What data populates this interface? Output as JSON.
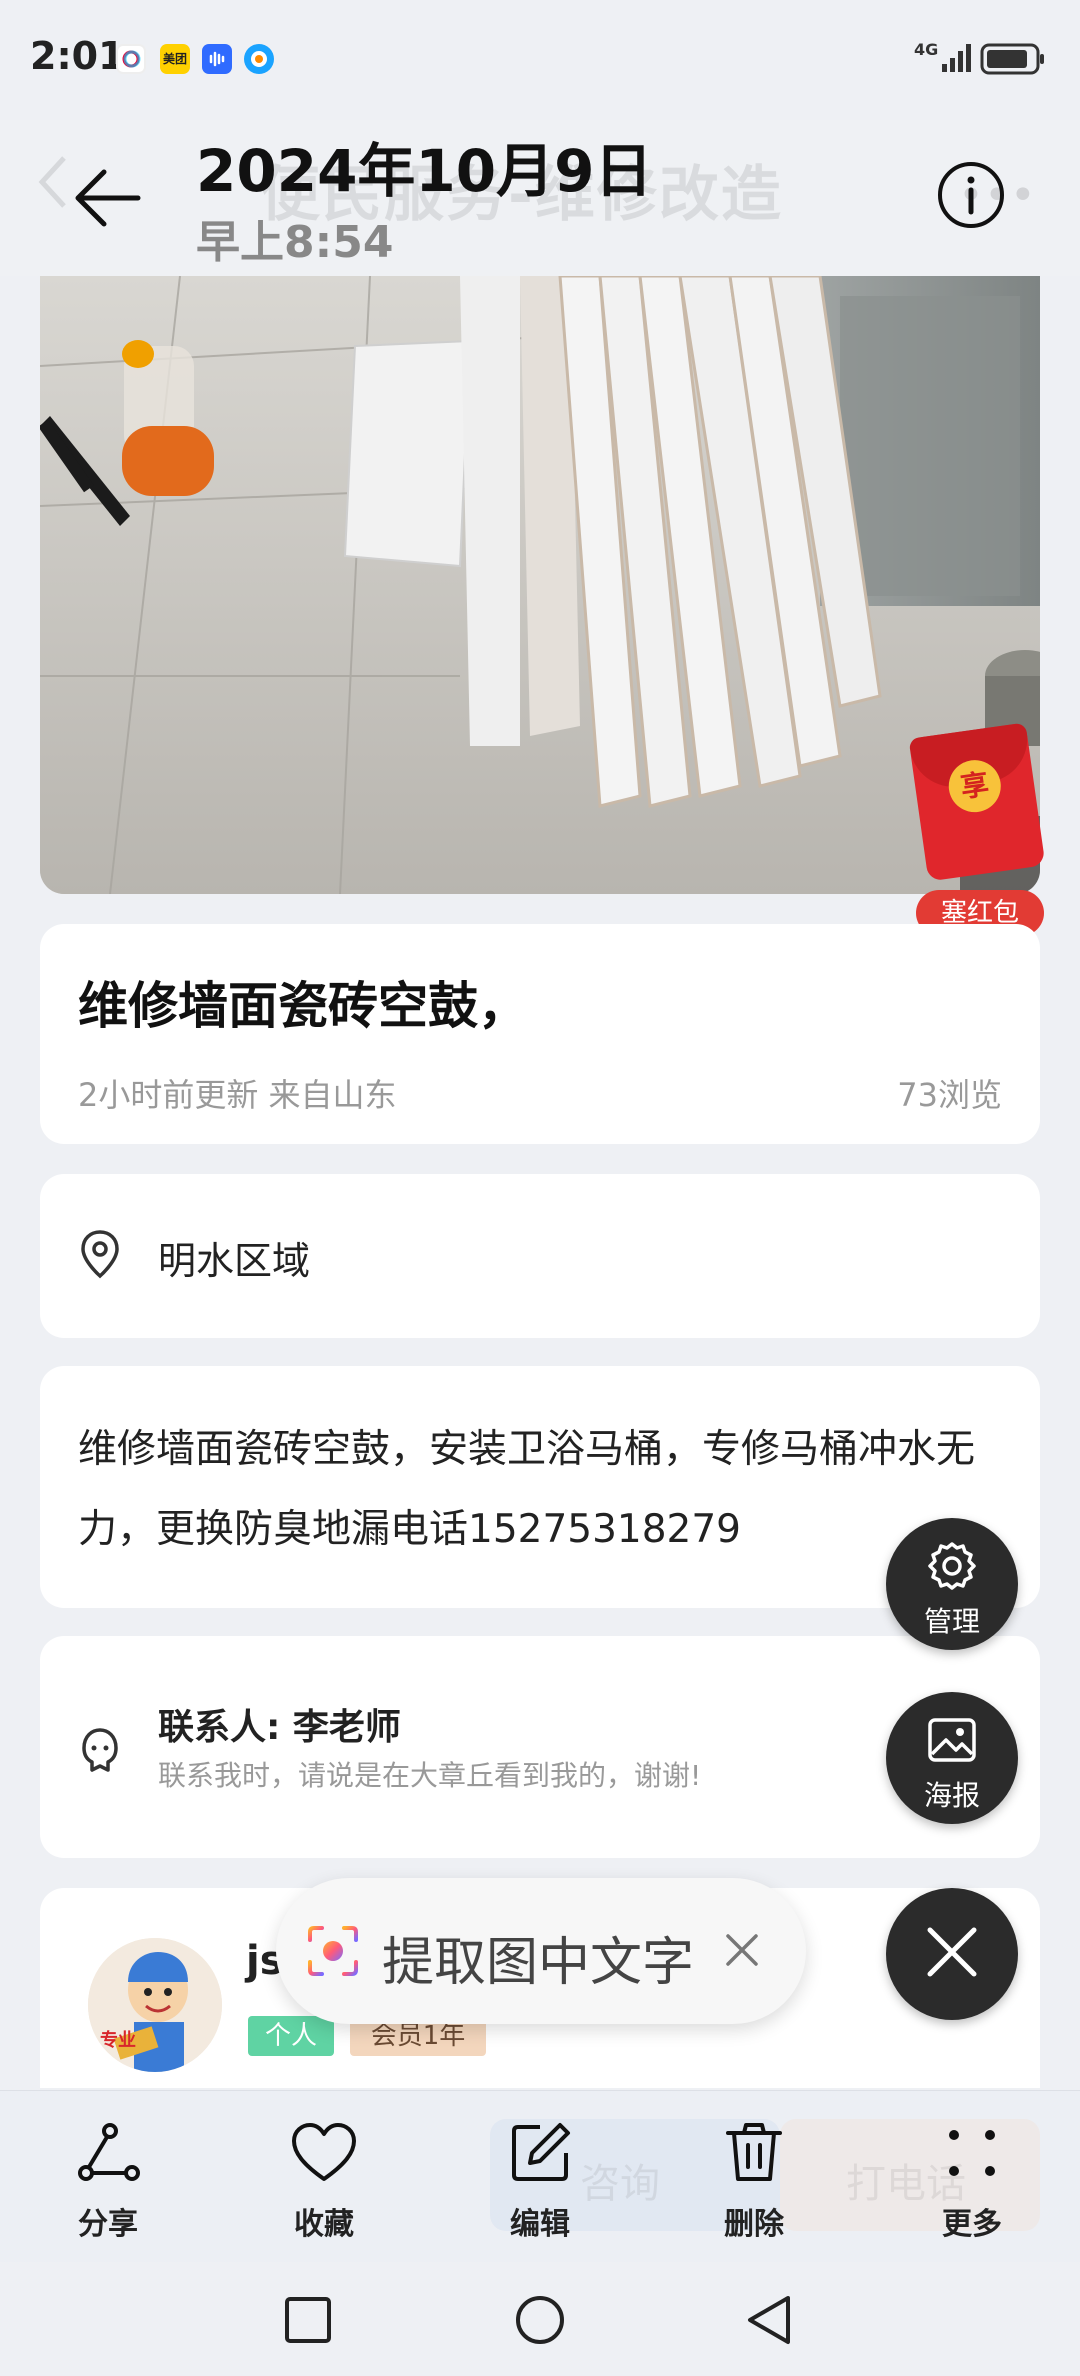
{
  "status_bar": {
    "time": "2:01",
    "network": "4G",
    "app_icons": [
      {
        "name": "tiktok-icon",
        "color": "#1a1a1a"
      },
      {
        "name": "meituan-icon",
        "color": "#ffd100",
        "label": "美团"
      },
      {
        "name": "voice-icon",
        "color": "#2f6bff"
      },
      {
        "name": "browser-icon",
        "color": "#1aa3ff"
      }
    ]
  },
  "header": {
    "date": "2024年10月9日",
    "time": "早上8:54",
    "ghost_title": "便民服务-维修改造"
  },
  "listing": {
    "title": "维修墙面瓷砖空鼓，",
    "meta": "2小时前更新 来自山东",
    "views": "73浏览",
    "location": "明水区域",
    "description": "维修墙面瓷砖空鼓，安装卫浴马桶，专修马桶冲水无力，更换防臭地漏电话15275318279",
    "contact_name": "联系人: 李老师",
    "contact_hint": "联系我时，请说是在大章丘看到我的，谢谢!"
  },
  "red_envelope": {
    "coin": "享",
    "label": "塞红包"
  },
  "publisher": {
    "name": "js",
    "tag_type": "个人",
    "tag_member": "会员1年",
    "avatar_caption": "专业"
  },
  "fabs": {
    "manage": "管理",
    "poster": "海报"
  },
  "extract": {
    "label": "提取图中文字"
  },
  "toolbar": {
    "share": "分享",
    "favorite": "收藏",
    "edit": "编辑",
    "delete": "删除",
    "more": "更多",
    "ghost_consult": "咨询",
    "ghost_call": "打电话"
  },
  "colors": {
    "accent_red": "#e23b34",
    "tag_green": "#5fd3a3",
    "tag_member": "#f3d6bd",
    "fab_dark": "#2b2b2b"
  }
}
